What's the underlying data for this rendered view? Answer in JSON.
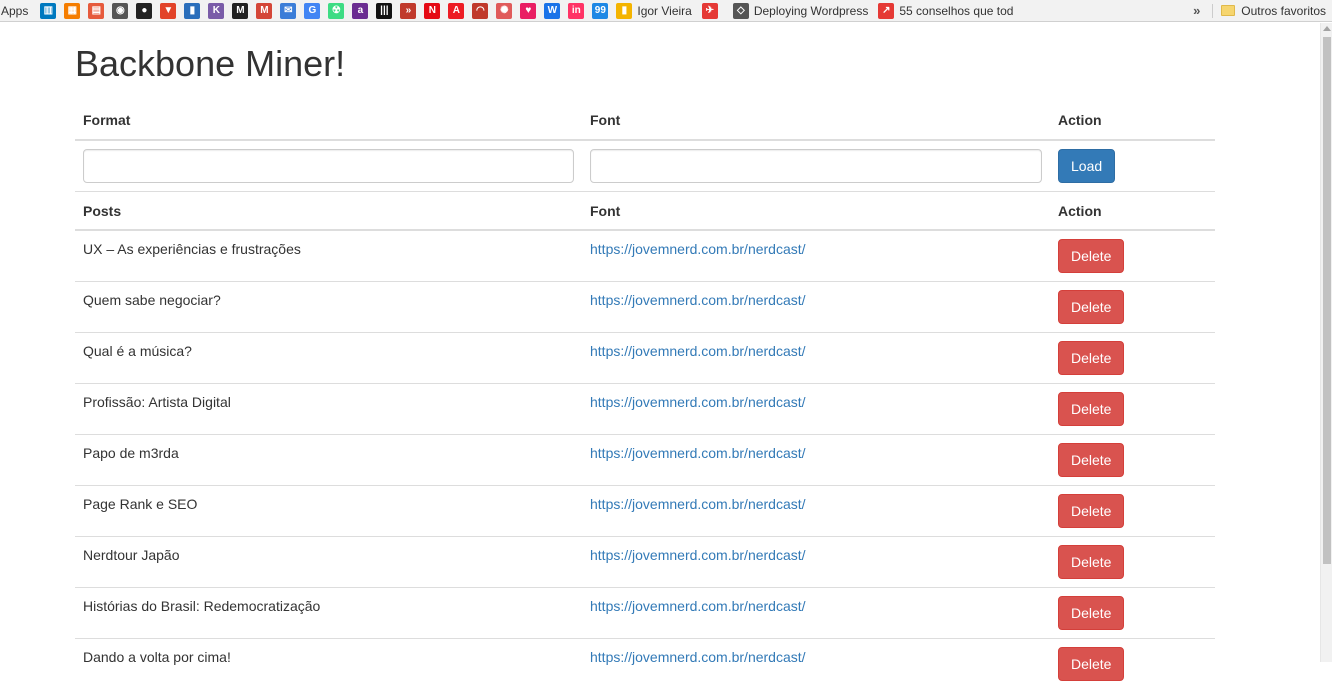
{
  "bookmarks": {
    "apps_label": "Apps",
    "icons": [
      {
        "name": "trello-icon",
        "color": "#0079bf",
        "glyph": "▥"
      },
      {
        "name": "blogger-icon",
        "color": "#f57d00",
        "glyph": "▦"
      },
      {
        "name": "calendar-icon",
        "color": "#e65a3c",
        "glyph": "▤"
      },
      {
        "name": "camera-icon",
        "color": "#555555",
        "glyph": "◉"
      },
      {
        "name": "github-icon",
        "color": "#222222",
        "glyph": "●"
      },
      {
        "name": "gitlab-icon",
        "color": "#e24329",
        "glyph": "▼"
      },
      {
        "name": "jar-icon",
        "color": "#2a6ebb",
        "glyph": "▮"
      },
      {
        "name": "k-icon",
        "color": "#7a5ca8",
        "glyph": "K"
      },
      {
        "name": "m-dark-icon",
        "color": "#222222",
        "glyph": "M"
      },
      {
        "name": "gmail-icon",
        "color": "#d44638",
        "glyph": "M"
      },
      {
        "name": "mail-check-icon",
        "color": "#3b7dd8",
        "glyph": "✉"
      },
      {
        "name": "google-icon",
        "color": "#4285f4",
        "glyph": "G"
      },
      {
        "name": "android-icon",
        "color": "#3ddc84",
        "glyph": "☢"
      },
      {
        "name": "a-purple-icon",
        "color": "#6a2c91",
        "glyph": "a"
      },
      {
        "name": "barcode-icon",
        "color": "#111111",
        "glyph": "|||"
      },
      {
        "name": "chevrons-icon",
        "color": "#c0392b",
        "glyph": "»"
      },
      {
        "name": "netflix-icon",
        "color": "#e50914",
        "glyph": "N"
      },
      {
        "name": "adobe-icon",
        "color": "#ed1c24",
        "glyph": "A"
      },
      {
        "name": "gauge-icon",
        "color": "#c0392b",
        "glyph": "◠"
      },
      {
        "name": "react-icon",
        "color": "#e05a5a",
        "glyph": "✺"
      },
      {
        "name": "heart-icon",
        "color": "#e91e63",
        "glyph": "♥"
      },
      {
        "name": "w-icon",
        "color": "#1a73e8",
        "glyph": "W"
      },
      {
        "name": "invision-icon",
        "color": "#ff3366",
        "glyph": "in"
      },
      {
        "name": "99-icon",
        "color": "#1e88e5",
        "glyph": "99"
      }
    ],
    "links": [
      {
        "name": "igor-vieira-bookmark",
        "icon": "bookmark-yellow-icon",
        "color": "#f4b400",
        "glyph": "▮",
        "label": "Igor Vieira"
      },
      {
        "name": "deploying-wordpress-bookmark",
        "icon": "plane-icon",
        "color": "#e53935",
        "glyph": "✈",
        "label": ""
      },
      {
        "name": "deploying-wordpress-link",
        "icon": "diamond-icon",
        "color": "#555555",
        "glyph": "◇",
        "label": "Deploying Wordpress"
      },
      {
        "name": "conselhos-bookmark",
        "icon": "trending-icon",
        "color": "#e53935",
        "glyph": "↗",
        "label": "55 conselhos que tod"
      }
    ],
    "more": "»",
    "other_label": "Outros favoritos"
  },
  "page": {
    "title": "Backbone Miner!"
  },
  "form_table": {
    "headers": [
      "Format",
      "Font",
      "Action"
    ],
    "format_value": "",
    "font_value": "",
    "load_label": "Load"
  },
  "posts_table": {
    "headers": [
      "Posts",
      "Font",
      "Action"
    ],
    "delete_label": "Delete",
    "rows": [
      {
        "title": "UX – As experiências e frustrações",
        "font": "https://jovemnerd.com.br/nerdcast/"
      },
      {
        "title": "Quem sabe negociar?",
        "font": "https://jovemnerd.com.br/nerdcast/"
      },
      {
        "title": "Qual é a música?",
        "font": "https://jovemnerd.com.br/nerdcast/"
      },
      {
        "title": "Profissão: Artista Digital",
        "font": "https://jovemnerd.com.br/nerdcast/"
      },
      {
        "title": "Papo de m3rda",
        "font": "https://jovemnerd.com.br/nerdcast/"
      },
      {
        "title": "Page Rank e SEO",
        "font": "https://jovemnerd.com.br/nerdcast/"
      },
      {
        "title": "Nerdtour Japão",
        "font": "https://jovemnerd.com.br/nerdcast/"
      },
      {
        "title": "Histórias do Brasil: Redemocratização",
        "font": "https://jovemnerd.com.br/nerdcast/"
      },
      {
        "title": "Dando a volta por cima!",
        "font": "https://jovemnerd.com.br/nerdcast/"
      }
    ]
  },
  "colors": {
    "primary": "#337ab7",
    "danger": "#d9534f",
    "link": "#337ab7"
  }
}
